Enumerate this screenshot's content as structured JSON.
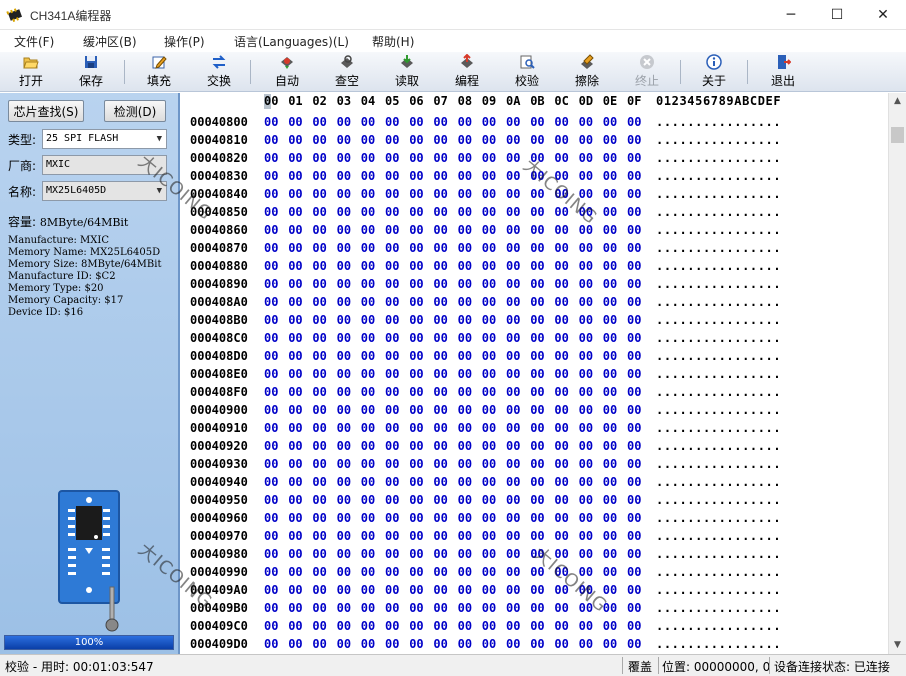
{
  "window": {
    "title": "CH341A编程器",
    "min": "─",
    "max": "☐",
    "close": "✕"
  },
  "menu": [
    "文件(F)",
    "缓冲区(B)",
    "操作(P)",
    "语言(Languages)(L)",
    "帮助(H)"
  ],
  "toolbar": [
    {
      "label": "打开",
      "icon": "folder-open-icon",
      "enabled": true
    },
    {
      "label": "保存",
      "icon": "save-disk-icon",
      "enabled": true
    },
    {
      "label": "填充",
      "icon": "fill-pencil-icon",
      "enabled": true
    },
    {
      "label": "交换",
      "icon": "swap-arrows-icon",
      "enabled": true
    },
    {
      "label": "自动",
      "icon": "auto-chip-icon",
      "enabled": true
    },
    {
      "label": "查空",
      "icon": "blank-check-icon",
      "enabled": true
    },
    {
      "label": "读取",
      "icon": "read-chip-icon",
      "enabled": true
    },
    {
      "label": "编程",
      "icon": "program-chip-icon",
      "enabled": true
    },
    {
      "label": "校验",
      "icon": "verify-icon",
      "enabled": true
    },
    {
      "label": "擦除",
      "icon": "erase-icon",
      "enabled": true
    },
    {
      "label": "终止",
      "icon": "stop-icon",
      "enabled": false
    },
    {
      "label": "关于",
      "icon": "info-icon",
      "enabled": true
    },
    {
      "label": "退出",
      "icon": "exit-door-icon",
      "enabled": true
    }
  ],
  "left": {
    "find_chip": "芯片查找(S)",
    "detect": "检测(D)",
    "type_label": "类型:",
    "type_value": "25 SPI FLASH",
    "vendor_label": "厂商:",
    "vendor_value": "MXIC",
    "name_label": "名称:",
    "name_value": "MX25L6405D",
    "capacity_label": "容量:",
    "capacity_value": "8MByte/64MBit",
    "info": [
      "Manufacture: MXIC",
      "Memory Name: MX25L6405D",
      "Memory Size: 8MByte/64MBit",
      "Manufacture ID: $C2",
      "Memory Type: $20",
      "Memory Capacity: $17",
      "Device ID: $16"
    ],
    "progress_value": 1.0,
    "progress_text": "100%"
  },
  "hex": {
    "columns": [
      "00",
      "01",
      "02",
      "03",
      "04",
      "05",
      "06",
      "07",
      "08",
      "09",
      "0A",
      "0B",
      "0C",
      "0D",
      "0E",
      "0F"
    ],
    "ascii_header": "0123456789ABCDEF",
    "addresses": [
      "00040800",
      "00040810",
      "00040820",
      "00040830",
      "00040840",
      "00040850",
      "00040860",
      "00040870",
      "00040880",
      "00040890",
      "000408A0",
      "000408B0",
      "000408C0",
      "000408D0",
      "000408E0",
      "000408F0",
      "00040900",
      "00040910",
      "00040920",
      "00040930",
      "00040940",
      "00040950",
      "00040960",
      "00040970",
      "00040980",
      "00040990",
      "000409A0",
      "000409B0",
      "000409C0",
      "000409D0"
    ],
    "byte_value": "00",
    "ascii_row": "................"
  },
  "watermarks": [
    "大ICOING",
    "大ICOING",
    "大ICOING",
    "大ICOING"
  ],
  "status": {
    "op": "校验 - 用时: 00:01:03:547",
    "mode": "覆盖",
    "position": "位置: 00000000, 0",
    "conn": "设备连接状态: 已连接"
  }
}
